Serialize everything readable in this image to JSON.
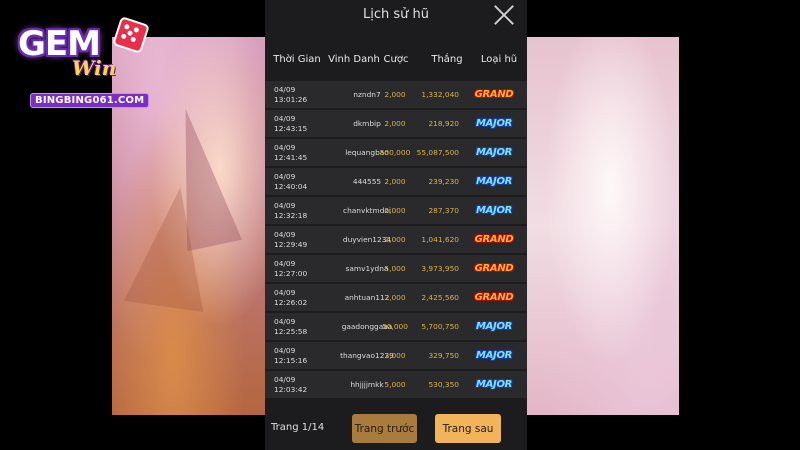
{
  "logo": {
    "brand": "GEM",
    "sub": "Win",
    "url": "BINGBING061.COM"
  },
  "panel": {
    "title": "Lịch sử hũ",
    "columns": [
      "Thời Gian",
      "Vinh Danh",
      "Cược",
      "Thắng",
      "Loại hũ"
    ],
    "rows": [
      {
        "date": "04/09",
        "time": "13:01:26",
        "name": "nzndn7",
        "bet": "2,000",
        "win": "1,332,040",
        "type": "GRAND"
      },
      {
        "date": "04/09",
        "time": "12:43:15",
        "name": "dkmbip",
        "bet": "2,000",
        "win": "218,920",
        "type": "MAJOR"
      },
      {
        "date": "04/09",
        "time": "12:41:45",
        "name": "lequangbao",
        "bet": "500,000",
        "win": "55,087,500",
        "type": "MAJOR"
      },
      {
        "date": "04/09",
        "time": "12:40:04",
        "name": "444555",
        "bet": "2,000",
        "win": "239,230",
        "type": "MAJOR"
      },
      {
        "date": "04/09",
        "time": "12:32:18",
        "name": "chanvktmdoi",
        "bet": "2,000",
        "win": "287,370",
        "type": "MAJOR"
      },
      {
        "date": "04/09",
        "time": "12:29:49",
        "name": "duyvien1234",
        "bet": "2,000",
        "win": "1,041,620",
        "type": "GRAND"
      },
      {
        "date": "04/09",
        "time": "12:27:00",
        "name": "samv1ydna",
        "bet": "5,000",
        "win": "3,973,950",
        "type": "GRAND"
      },
      {
        "date": "04/09",
        "time": "12:26:02",
        "name": "anhtuan112",
        "bet": "2,000",
        "win": "2,425,560",
        "type": "GRAND"
      },
      {
        "date": "04/09",
        "time": "12:25:58",
        "name": "gaadonggaaa",
        "bet": "50,000",
        "win": "5,700,750",
        "type": "MAJOR"
      },
      {
        "date": "04/09",
        "time": "12:15:16",
        "name": "thangvao1239",
        "bet": "2,000",
        "win": "329,750",
        "type": "MAJOR"
      },
      {
        "date": "04/09",
        "time": "12:03:42",
        "name": "hhjjjjmkk",
        "bet": "5,000",
        "win": "530,350",
        "type": "MAJOR"
      }
    ]
  },
  "pagination": {
    "label": "Trang 1/14",
    "prev_label": "Trang trước",
    "next_label": "Trang sau"
  },
  "colors": {
    "panel_bg": "#1c1c1e",
    "row_bg": "#2a2a2d",
    "amount": "#d8b44a",
    "prev_button": "#a87b3e",
    "next_button": "#f2b45a"
  },
  "icons": {
    "close": "close-icon",
    "die": "dice-icon"
  }
}
